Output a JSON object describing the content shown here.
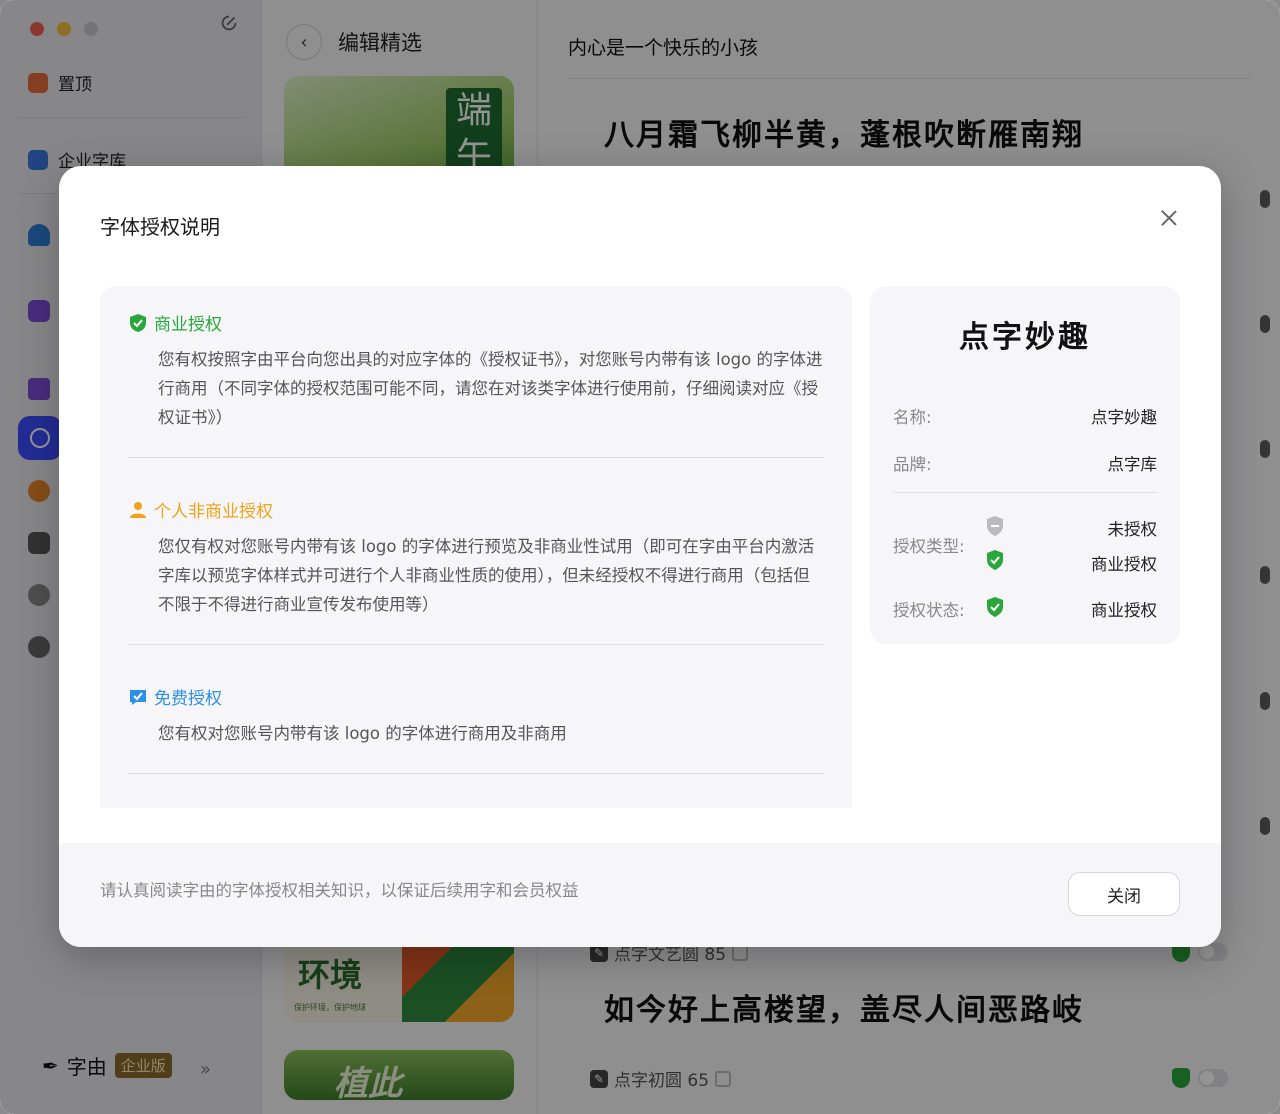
{
  "sidebar": {
    "items": [
      {
        "label": "置顶",
        "icon": "pin-icon",
        "color": "#e46b3c"
      },
      {
        "label": "企业字库",
        "icon": "enterprise-library-icon",
        "color": "#3a78e0"
      }
    ],
    "brand": {
      "name": "字由",
      "badge": "企业版",
      "more": "»"
    }
  },
  "middle": {
    "back": "‹",
    "title": "编辑精选",
    "cards": [
      {
        "text": "端午"
      },
      {
        "text": "环境",
        "sub": "保护环境，保护地球"
      },
      {
        "text": "植此"
      }
    ]
  },
  "right": {
    "title": "内心是一个快乐的小孩",
    "samples": [
      "八月霜飞柳半黄，蓬根吹断雁南翔",
      "如今好上高楼望，盖尽人间恶路岐"
    ],
    "fonts": [
      {
        "name": "点字文艺圆 85"
      },
      {
        "name": "点字初圆 65"
      }
    ]
  },
  "modal": {
    "title": "字体授权说明",
    "licenses": [
      {
        "title": "商业授权",
        "color": "#2aa73a",
        "icon": "shield-check-icon",
        "body": "您有权按照字由平台向您出具的对应字体的《授权证书》，对您账号内带有该 logo 的字体进行商用（不同字体的授权范围可能不同，请您在对该类字体进行使用前，仔细阅读对应《授权证书》）"
      },
      {
        "title": "个人非商业授权",
        "color": "#f0a21b",
        "icon": "person-icon",
        "body": "您仅有权对您账号内带有该 logo 的字体进行预览及非商业性试用（即可在字由平台内激活字库以预览字体样式并可进行个人非商业性质的使用），但未经授权不得进行商用（包括但不限于不得进行商业宣传发布使用等）"
      },
      {
        "title": "免费授权",
        "color": "#2e8fe8",
        "icon": "free-check-icon",
        "body": "您有权对您账号内带有该 logo 的字体进行商用及非商用"
      }
    ],
    "info": {
      "font_preview": "点字妙趣",
      "name_label": "名称:",
      "name_value": "点字妙趣",
      "brand_label": "品牌:",
      "brand_value": "点字库",
      "type_label": "授权类型:",
      "type_values": [
        "未授权",
        "商业授权"
      ],
      "status_label": "授权状态:",
      "status_value": "商业授权"
    },
    "footer_text": "请认真阅读字由的字体授权相关知识，以保证后续用字和会员权益",
    "close_label": "关闭"
  }
}
